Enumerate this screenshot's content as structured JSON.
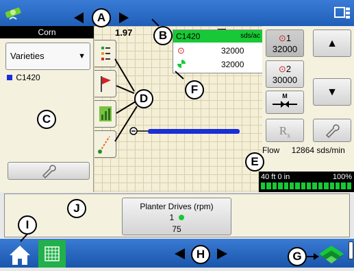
{
  "topbar": {
    "icons": [
      "satellite-icon",
      "monitor-menu-icon"
    ]
  },
  "speed": "1.97",
  "left": {
    "crop": "Corn",
    "varieties": "Varieties",
    "variety_item": "C1420",
    "variety_color": "#1a2fd6"
  },
  "rate_box": {
    "product": "C1420",
    "units": "sds/ac",
    "row1_value": "32000",
    "row2_value": "32000"
  },
  "right": {
    "rate1_label": "1",
    "rate1_value": "32000",
    "rate2_label": "2",
    "rate2_value": "30000",
    "manual_label": "M",
    "rx_label": "R"
  },
  "flow": {
    "label": "Flow",
    "value": "12864",
    "units": "sds/min"
  },
  "width": {
    "text": "40 ft 0 in",
    "percent": "100%"
  },
  "bottom": {
    "drives_title": "Planter Drives (rpm)",
    "drive_num": "1",
    "drive_value": "75"
  },
  "callouts": [
    "A",
    "B",
    "C",
    "D",
    "E",
    "F",
    "G",
    "H",
    "I",
    "J"
  ],
  "colors": {
    "accent": "#1f5fb8",
    "green": "#17c936",
    "map": "#f4efd6"
  }
}
